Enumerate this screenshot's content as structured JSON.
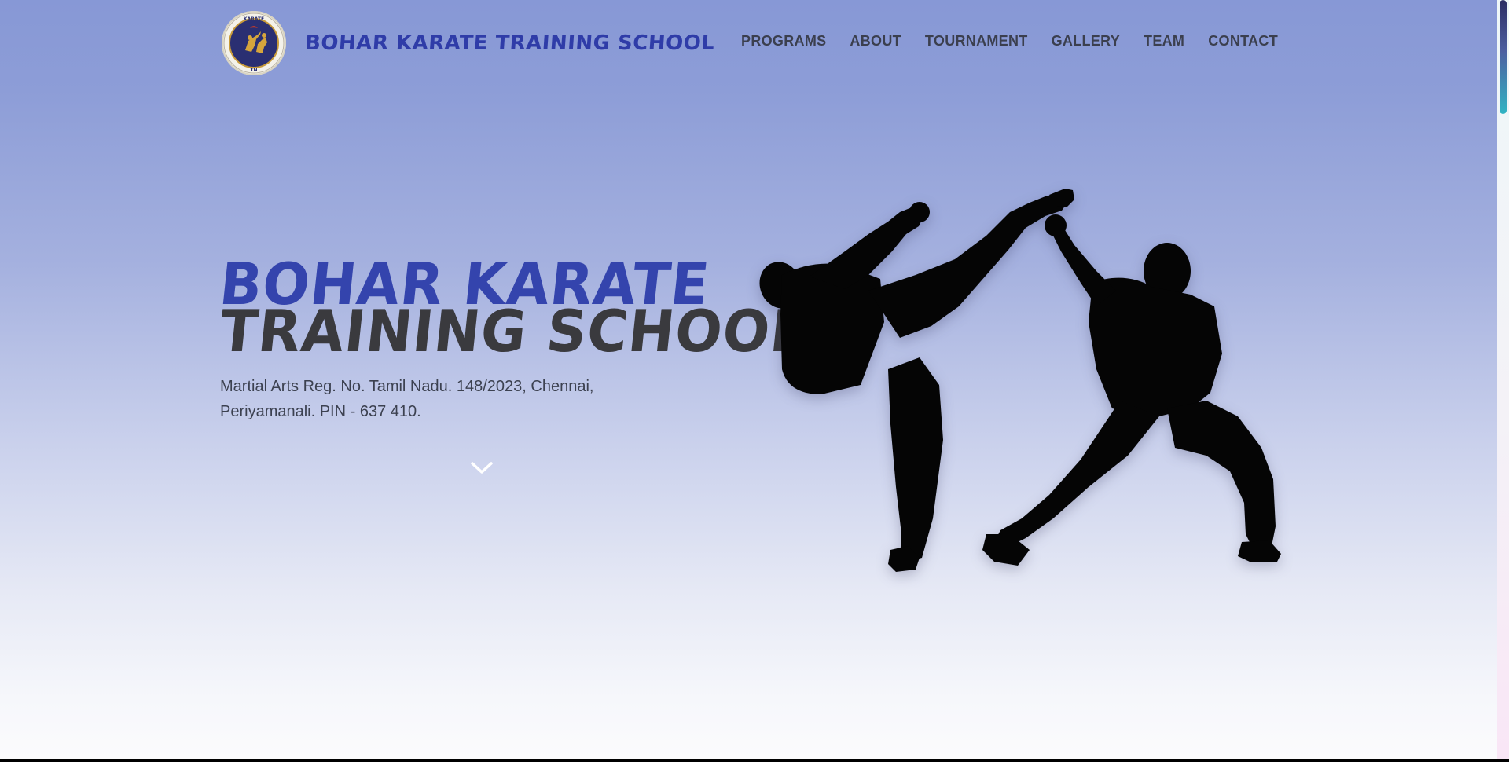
{
  "brand": {
    "name": "BOHAR KARATE TRAINING SCHOOL",
    "logo_icon": "karate-school-emblem-icon"
  },
  "nav": {
    "items": [
      {
        "label": "PROGRAMS"
      },
      {
        "label": "ABOUT"
      },
      {
        "label": "TOURNAMENT"
      },
      {
        "label": "GALLERY"
      },
      {
        "label": "TEAM"
      },
      {
        "label": "CONTACT"
      }
    ]
  },
  "hero": {
    "title_line1": "BOHAR KARATE",
    "title_line2": "TRAINING SCHOOL",
    "subtitle": "Martial Arts Reg. No. Tamil Nadu. 148/2023, Chennai, Periyamanali. PIN - 637 410.",
    "scroll_icon": "chevron-down-icon",
    "image_icon": "karate-fighters-silhouette"
  },
  "colors": {
    "brand_blue": "#2f3ca8",
    "hero_blue": "#3444ad",
    "hero_dark": "#3a3a3e",
    "nav_text": "#3b3f4e"
  }
}
